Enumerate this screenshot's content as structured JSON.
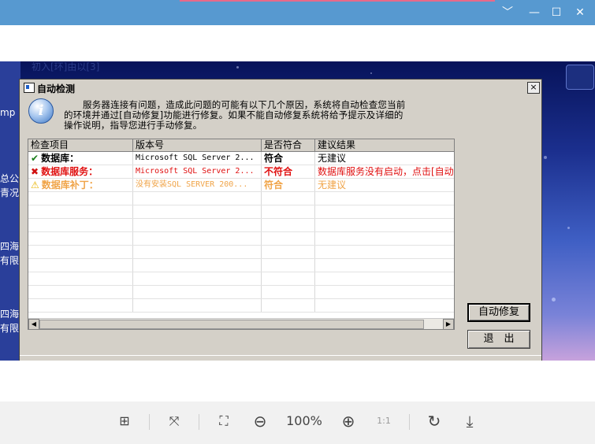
{
  "window": {
    "controls": {
      "minimize": "﹀",
      "restore": "—",
      "maximize": "☐",
      "close": "✕"
    }
  },
  "desktop": {
    "labels": [
      "mp",
      "总公",
      "青况",
      "四海",
      "有限",
      "四海",
      "有限"
    ],
    "top_text": "初入[环]由以[3]"
  },
  "dialog": {
    "title": "自动检测",
    "close": "×",
    "message_line1": "服务器连接有问题，造成此问题的可能有以下几个原因，系统将自动检查您当前",
    "message_line2": "的环境并通过[自动修复]功能进行修复。如果不能自动修复系统将给予提示及详细的",
    "message_line3": "操作说明，指导您进行手动修复。",
    "columns": [
      "检查项目",
      "版本号",
      "是否符合",
      "建议结果"
    ],
    "rows": [
      {
        "icon": "✔",
        "item": "数据库：",
        "version": "Microsoft SQL Server 2...",
        "ok": "符合",
        "advice": "无建议",
        "color": "#000000",
        "icon_color": "#1a7d1a"
      },
      {
        "icon": "✖",
        "item": "数据库服务：",
        "version": "Microsoft SQL Server 2...",
        "ok": "不符合",
        "advice": "数据库服务没有启动，点击[自动修",
        "color": "#e01010",
        "icon_color": "#d01010"
      },
      {
        "icon": "⚠",
        "item": "数据库补丁：",
        "version": "没有安装SQL SERVER 200...",
        "ok": "符合",
        "advice": "无建议",
        "color": "#f0a448",
        "icon_color": "#e8b400"
      }
    ],
    "scroll_left": "◀",
    "scroll_right": "▶",
    "auto_repair": "自动修复",
    "exit": "退　出"
  },
  "toolbar": {
    "layout_icon": "⊞",
    "fit_icon": "⤧",
    "fullscreen_icon": "⛶",
    "zoom_out_icon": "⊖",
    "zoom": "100%",
    "zoom_in_icon": "⊕",
    "actual_size": "1:1",
    "rotate_icon": "↻",
    "download_icon": "⤓"
  }
}
